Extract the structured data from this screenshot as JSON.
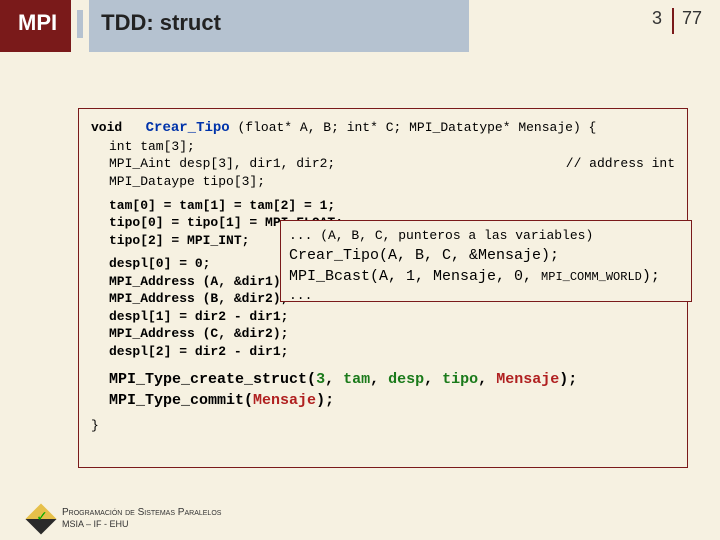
{
  "header": {
    "mpi": "MPI",
    "title": "TDD: struct"
  },
  "pages": {
    "current": "3",
    "total": "77"
  },
  "code": {
    "l1a": "void",
    "l1b": "Crear_Tipo",
    "l1c": " (float* A, B; int* C; MPI_Datatype* Mensaje) {",
    "l2": "int          tam[3];",
    "l3": "MPI_Aint     desp[3], dir1, dir2;",
    "l3c": "// address int",
    "l4": "MPI_Dataype  tipo[3];",
    "l5": "tam[0] = tam[1] = tam[2] = 1;",
    "l6": "tipo[0] = tipo[1] = MPI_FLOAT;",
    "l7": "tipo[2] = MPI_INT;",
    "l8": "despl[0] = 0;",
    "l9": "MPI_Address (A, &dir1);",
    "l10": "MPI_Address (B, &dir2);",
    "l11": "despl[1] = dir2 - dir1;",
    "l12": "MPI_Address (C, &dir2);",
    "l13": "despl[2] = dir2 - dir1;",
    "struct_call_fn": "MPI_Type_create_struct",
    "struct_call_open": "(",
    "struct_arg1": "3",
    "struct_sep": ", ",
    "struct_arg2": "tam",
    "struct_arg3": "desp",
    "struct_arg4": "tipo",
    "struct_arg5": "Mensaje",
    "struct_call_close": ");",
    "commit_fn": "MPI_Type_commit",
    "commit_open": "(",
    "commit_arg": "Mensaje",
    "commit_close": ");",
    "brace": "}"
  },
  "overlay": {
    "l1": "... (A, B, C, punteros a las variables)",
    "l2a": "Crear_Tipo(A, B, C, &Mensaje);",
    "l3a": "MPI_Bcast(A, 1, Mensaje, 0, ",
    "l3b": "MPI_COMM_WORLD",
    "l3c": ");",
    "l4": "..."
  },
  "footer": {
    "line1": "Programación de Sistemas Paralelos",
    "line2": "MSIA – IF - EHU"
  }
}
